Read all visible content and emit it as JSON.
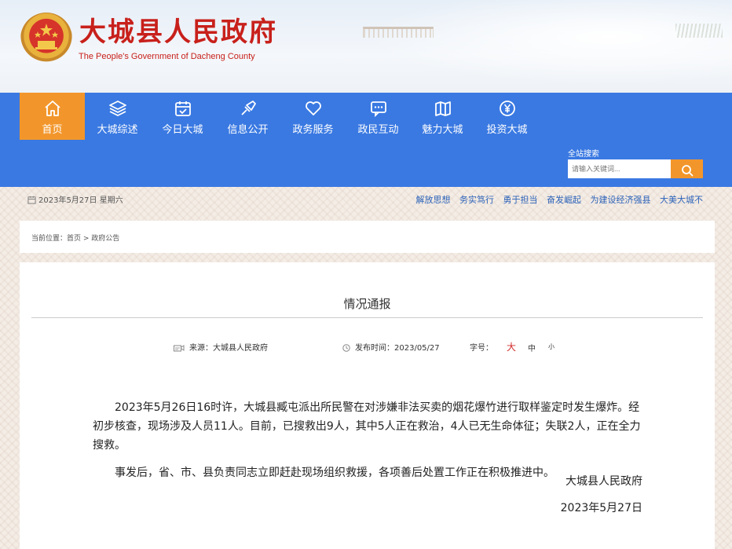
{
  "header": {
    "title": "大城县人民政府",
    "subtitle": "The People's Government of Dacheng County"
  },
  "nav": {
    "items": [
      {
        "label": "首页",
        "icon": "home-icon",
        "active": true
      },
      {
        "label": "大城综述",
        "icon": "layers-icon",
        "active": false
      },
      {
        "label": "今日大城",
        "icon": "calendar-icon",
        "active": false
      },
      {
        "label": "信息公开",
        "icon": "megaphone-icon",
        "active": false
      },
      {
        "label": "政务服务",
        "icon": "heart-icon",
        "active": false
      },
      {
        "label": "政民互动",
        "icon": "chat-icon",
        "active": false
      },
      {
        "label": "魅力大城",
        "icon": "map-icon",
        "active": false
      },
      {
        "label": "投资大城",
        "icon": "yen-icon",
        "active": false
      }
    ],
    "search_label": "全站搜索",
    "search_placeholder": "请输入关键词..."
  },
  "infobar": {
    "date": "2023年5月27日 星期六",
    "slogans": [
      "解放思想",
      "务实笃行",
      "勇于担当",
      "奋发崛起",
      "为建设经济强县",
      "大美大城不"
    ]
  },
  "breadcrumb": {
    "prefix": "当前位置：",
    "home": "首页",
    "separator": " > ",
    "current": "政府公告"
  },
  "article": {
    "title": "情况通报",
    "source_label": "来源：",
    "source": "大城县人民政府",
    "time_label": "发布时间：",
    "time": "2023/05/27",
    "font_label": "字号：",
    "font_large": "大",
    "font_medium": "中",
    "font_small": "小",
    "paragraph1": "2023年5月26日16时许，大城县臧屯派出所民警在对涉嫌非法买卖的烟花爆竹进行取样鉴定时发生爆炸。经初步核查，现场涉及人员11人。目前，已搜救出9人，其中5人正在救治，4人已无生命体征；失联2人，正在全力搜救。",
    "paragraph2": "事发后，省、市、县负责同志立即赶赴现场组织救援，各项善后处置工作正在积极推进中。",
    "signature": "大城县人民政府",
    "sign_date": "2023年5月27日"
  },
  "colors": {
    "nav_bg": "#3a79e2",
    "accent_orange": "#f2962b",
    "title_red": "#c8201b",
    "slogan_blue": "#2c62b8",
    "font_large_red": "#d12b2b"
  }
}
